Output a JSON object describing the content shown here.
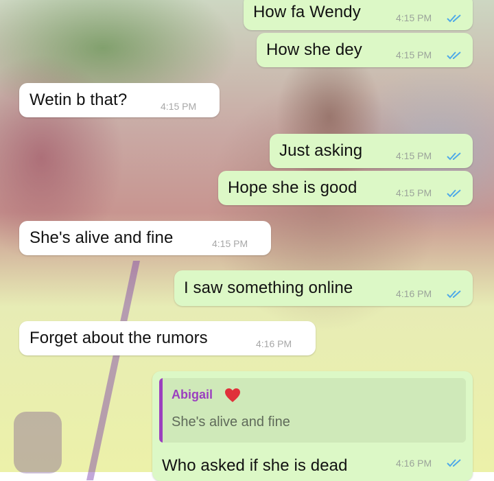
{
  "chat": {
    "messages": [
      {
        "direction": "outgoing",
        "text": "How fa Wendy",
        "time": "4:15 PM",
        "status_icon": "double-check-read-icon"
      },
      {
        "direction": "outgoing",
        "text": "How she dey",
        "time": "4:15 PM",
        "status_icon": "double-check-read-icon"
      },
      {
        "direction": "incoming",
        "text": "Wetin b that?",
        "time": "4:15 PM"
      },
      {
        "direction": "outgoing",
        "text": "Just asking",
        "time": "4:15 PM",
        "status_icon": "double-check-read-icon"
      },
      {
        "direction": "outgoing",
        "text": "Hope she is good",
        "time": "4:15 PM",
        "status_icon": "double-check-read-icon"
      },
      {
        "direction": "incoming",
        "text": "She's alive and fine",
        "time": "4:15 PM"
      },
      {
        "direction": "outgoing",
        "text": "I saw something online",
        "time": "4:16 PM",
        "status_icon": "double-check-read-icon"
      },
      {
        "direction": "incoming",
        "text": "Forget about the rumors",
        "time": "4:16 PM"
      },
      {
        "direction": "outgoing",
        "text": "Who asked if she is dead",
        "time": "4:16 PM",
        "status_icon": "double-check-read-icon",
        "reply_to": {
          "author": "Abigail",
          "author_icon": "heart-icon",
          "text": "She's alive and fine"
        }
      }
    ]
  },
  "colors": {
    "outgoing_bubble": "#dcf8c6",
    "incoming_bubble": "#ffffff",
    "read_ticks": "#4fa9e8",
    "quote_author": "#9b3fbf",
    "heart": "#e0303a"
  }
}
